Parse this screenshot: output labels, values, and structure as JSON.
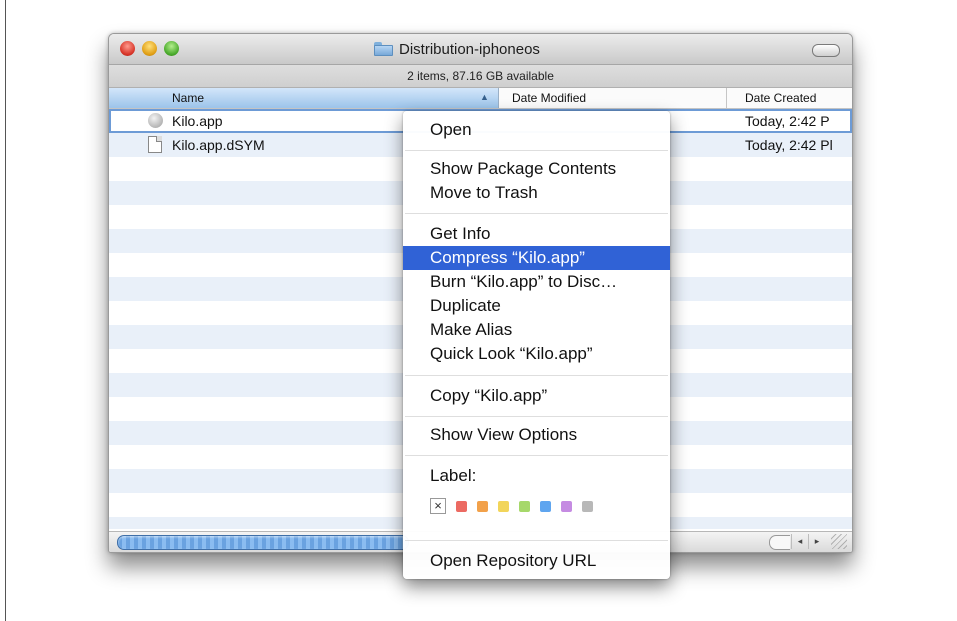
{
  "window": {
    "title": "Distribution-iphoneos",
    "status_text": "2 items, 87.16 GB available"
  },
  "columns": {
    "name": "Name",
    "date_modified": "Date Modified",
    "date_created": "Date Created"
  },
  "files": [
    {
      "name": "Kilo.app",
      "created": "Today, 2:42 P",
      "icon": "application-icon",
      "selected": true
    },
    {
      "name": "Kilo.app.dSYM",
      "created": "Today, 2:42 Pl",
      "icon": "document-icon",
      "selected": false
    }
  ],
  "context_menu": {
    "open": "Open",
    "show_package_contents": "Show Package Contents",
    "move_to_trash": "Move to Trash",
    "get_info": "Get Info",
    "compress": "Compress “Kilo.app”",
    "burn": "Burn “Kilo.app” to Disc…",
    "duplicate": "Duplicate",
    "make_alias": "Make Alias",
    "quick_look": "Quick Look “Kilo.app”",
    "copy": "Copy “Kilo.app”",
    "show_view_options": "Show View Options",
    "label_heading": "Label:",
    "no_label_mark": "×",
    "label_colors": [
      "#ec6a62",
      "#f2a14a",
      "#f2d55a",
      "#a6d86a",
      "#5fa5ef",
      "#c58be2",
      "#b8b8b8"
    ],
    "open_repository_url": "Open Repository URL",
    "highlighted_item": "compress"
  },
  "scrollbar": {
    "left_arrow": "◂",
    "right_arrow": "▸"
  },
  "colors": {
    "menu_highlight": "#3062d6",
    "row_stripe": "#e9f0f9",
    "header_sorted": "#9cc4ea"
  }
}
